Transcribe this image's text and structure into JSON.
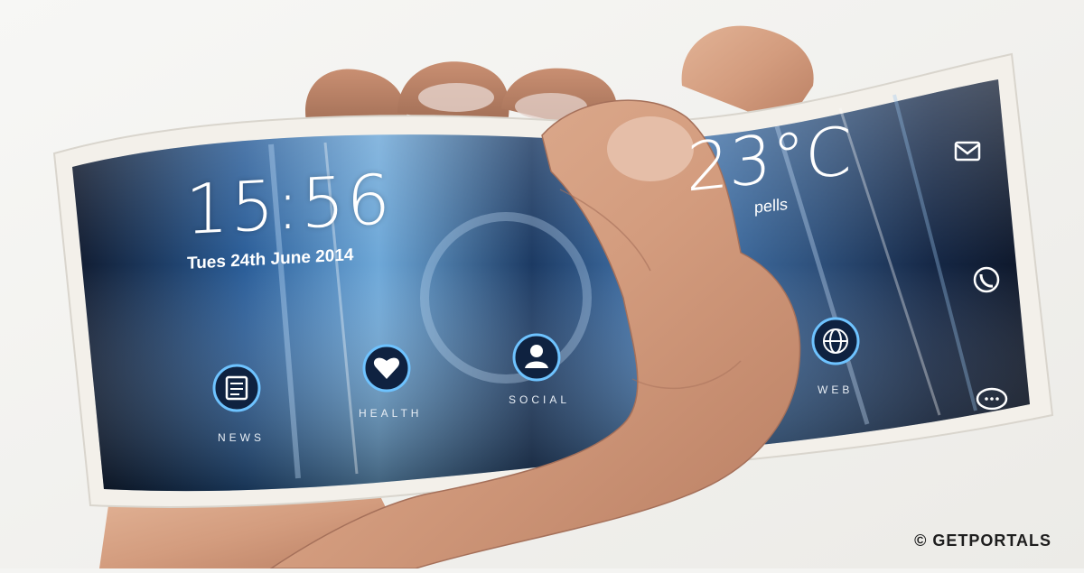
{
  "phone": {
    "time": "15:56",
    "date": "Tues 24th June 2014",
    "temperature": "23°C",
    "weather": "pells",
    "apps": [
      {
        "label": "NEWS",
        "icon": "news-icon"
      },
      {
        "label": "HEALTH",
        "icon": "heart-icon"
      },
      {
        "label": "SOCIAL",
        "icon": "user-icon"
      },
      {
        "label": "WEB",
        "icon": "globe-icon"
      }
    ],
    "side_icons": [
      "mail-icon",
      "phone-icon",
      "chat-icon"
    ]
  },
  "credit": "© GETPORTALS",
  "colors": {
    "screen_dark": "#0f1c33",
    "screen_blue": "#4a86c4",
    "icon_ring": "#6ec3ff",
    "bezel": "#f3f0ea",
    "skin": "#d7a386"
  }
}
